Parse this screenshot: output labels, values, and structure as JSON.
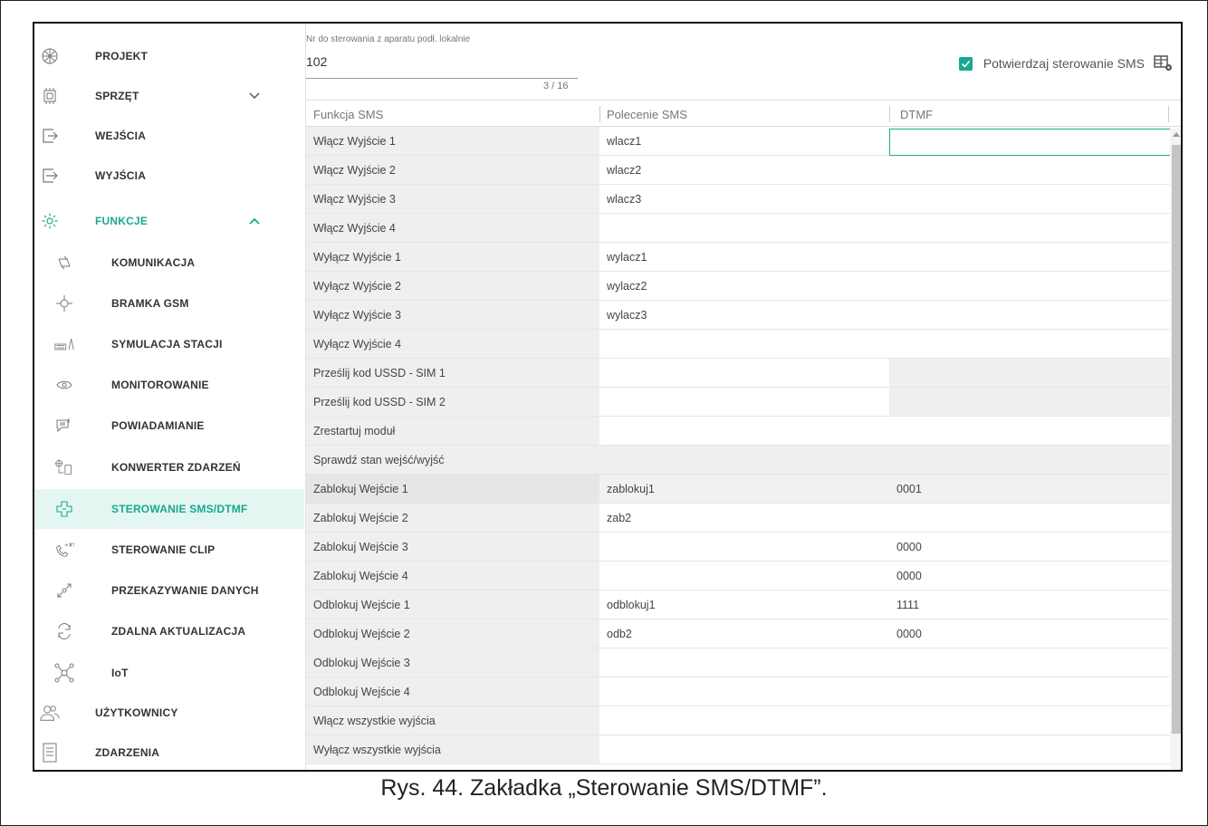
{
  "sidebar": {
    "items": [
      {
        "label": "PROJEKT",
        "icon": "project-icon"
      },
      {
        "label": "SPRZĘT",
        "icon": "hardware-icon"
      },
      {
        "label": "WEJŚCIA",
        "icon": "inputs-icon"
      },
      {
        "label": "WYJŚCIA",
        "icon": "outputs-icon"
      },
      {
        "label": "FUNKCJE",
        "icon": "gear-icon"
      }
    ],
    "sub_items": [
      {
        "label": "KOMUNIKACJA",
        "icon": "communication-icon"
      },
      {
        "label": "BRAMKA GSM",
        "icon": "gsm-gateway-icon"
      },
      {
        "label": "SYMULACJA STACJI",
        "icon": "station-simulation-icon"
      },
      {
        "label": "MONITOROWANIE",
        "icon": "eye-icon"
      },
      {
        "label": "POWIADAMIANIE",
        "icon": "notification-icon"
      },
      {
        "label": "KONWERTER ZDARZEŃ",
        "icon": "event-converter-icon"
      },
      {
        "label": "STEROWANIE SMS/DTMF",
        "icon": "sms-control-icon"
      },
      {
        "label": "STEROWANIE CLIP",
        "icon": "clip-phone-icon"
      },
      {
        "label": "PRZEKAZYWANIE DANYCH",
        "icon": "data-transfer-icon"
      },
      {
        "label": "ZDALNA AKTUALIZACJA",
        "icon": "remote-update-icon"
      },
      {
        "label": "IoT",
        "icon": "iot-icon"
      }
    ],
    "bottom_items": [
      {
        "label": "UŻYTKOWNICY",
        "icon": "users-icon"
      },
      {
        "label": "ZDARZENIA",
        "icon": "events-icon"
      }
    ],
    "selected": "STEROWANIE SMS/DTMF",
    "expanded": "FUNKCJE"
  },
  "phone_field": {
    "label": "Nr do sterowania z aparatu podł. lokalnie",
    "value": "102",
    "counter": "3 / 16"
  },
  "confirm_sms": {
    "label": "Potwierdzaj sterowanie SMS",
    "checked": true
  },
  "table": {
    "headers": [
      "Funkcja SMS",
      "Polecenie SMS",
      "DTMF"
    ],
    "rows": [
      [
        "Włącz Wyjście 1",
        "wlacz1",
        ""
      ],
      [
        "Włącz Wyjście 2",
        "wlacz2",
        ""
      ],
      [
        "Włącz Wyjście 3",
        "wlacz3",
        ""
      ],
      [
        "Włącz Wyjście 4",
        "",
        ""
      ],
      [
        "Wyłącz Wyjście 1",
        "wylacz1",
        ""
      ],
      [
        "Wyłącz Wyjście 2",
        "wylacz2",
        ""
      ],
      [
        "Wyłącz Wyjście 3",
        "wylacz3",
        ""
      ],
      [
        "Wyłącz Wyjście 4",
        "",
        ""
      ],
      [
        "Prześlij kod USSD - SIM 1",
        "",
        ""
      ],
      [
        "Prześlij kod USSD - SIM 2",
        "",
        ""
      ],
      [
        "Zrestartuj moduł",
        "",
        ""
      ],
      [
        "Sprawdź stan wejść/wyjść",
        "",
        ""
      ],
      [
        "Zablokuj Wejście 1",
        "zablokuj1",
        "0001"
      ],
      [
        "Zablokuj Wejście 2",
        "zab2",
        ""
      ],
      [
        "Zablokuj Wejście 3",
        "",
        "0000"
      ],
      [
        "Zablokuj Wejście 4",
        "",
        "0000"
      ],
      [
        "Odblokuj Wejście 1",
        "odblokuj1",
        "1111"
      ],
      [
        "Odblokuj Wejście 2",
        "odb2",
        "0000"
      ],
      [
        "Odblokuj Wejście 3",
        "",
        ""
      ],
      [
        "Odblokuj Wejście 4",
        "",
        ""
      ],
      [
        "Włącz wszystkie wyjścia",
        "",
        ""
      ],
      [
        "Wyłącz wszystkie wyjścia",
        "",
        ""
      ]
    ]
  },
  "caption": "Rys. 44. Zakładka „Sterowanie SMS/DTMF”.",
  "colors": {
    "accent": "#1aa890",
    "selected_bg": "#e4f6f2",
    "grey_cell": "#efefef"
  }
}
